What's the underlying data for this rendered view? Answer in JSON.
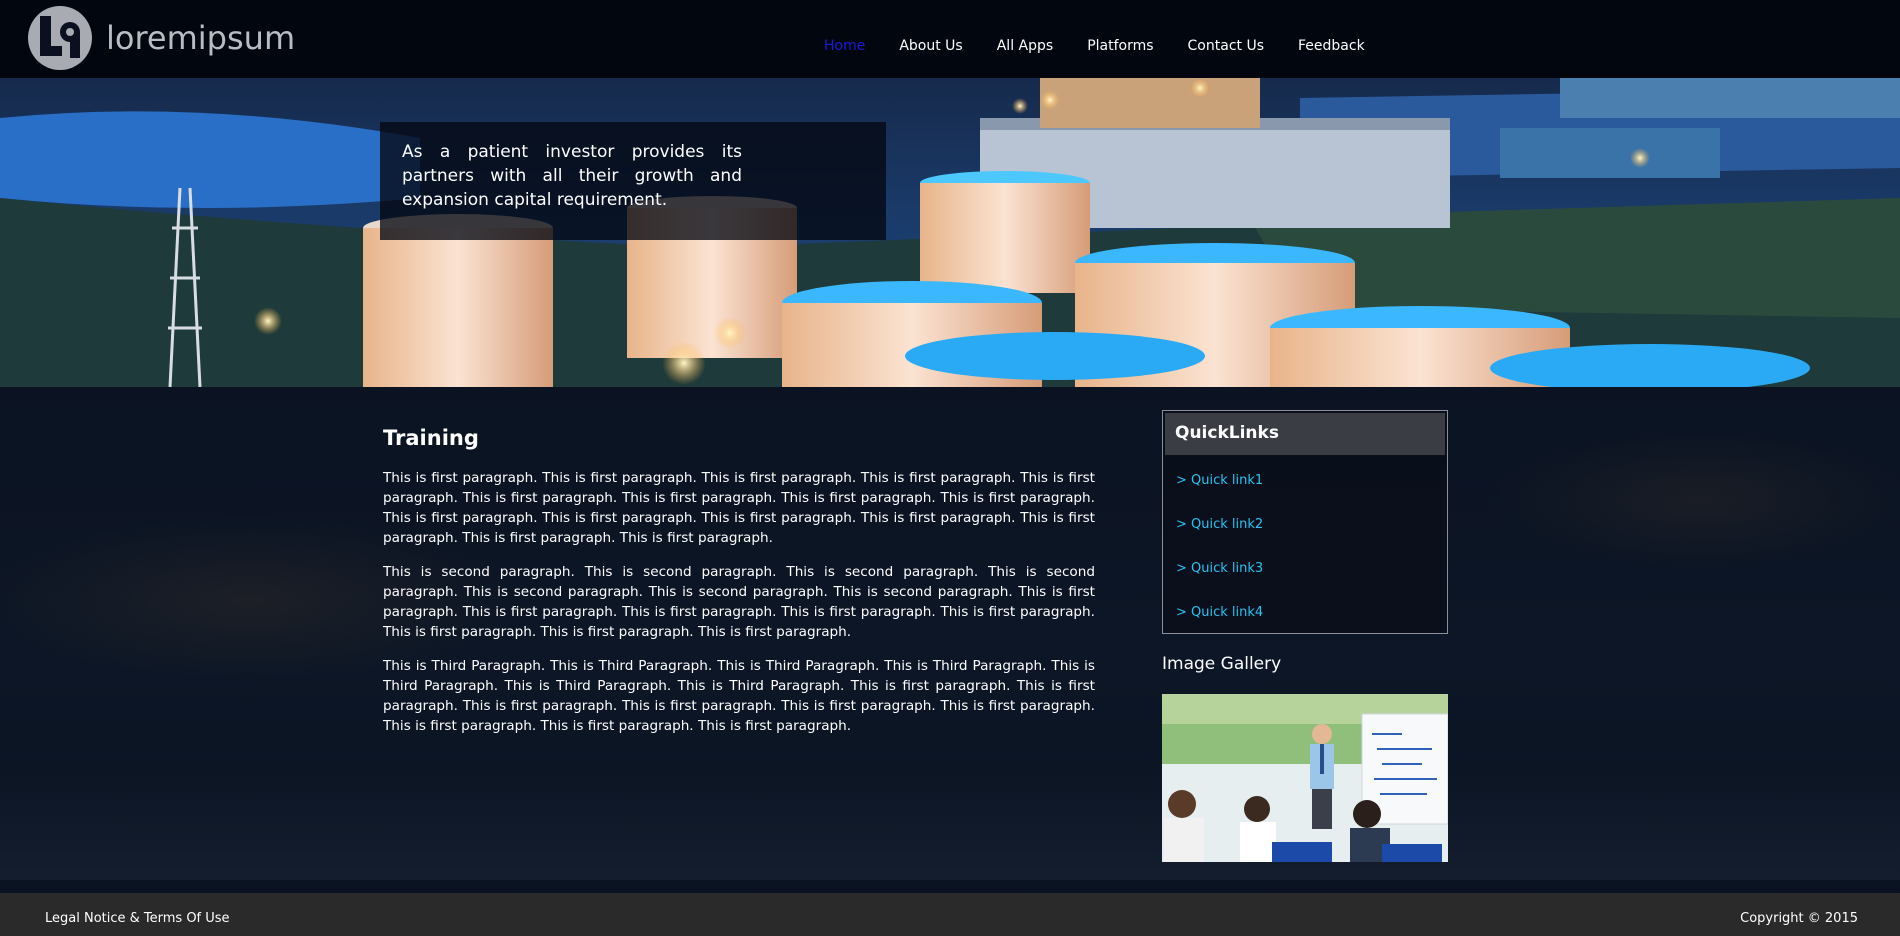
{
  "brand": {
    "name": "loremipsum"
  },
  "nav": {
    "items": [
      {
        "label": "Home",
        "active": true
      },
      {
        "label": "About Us"
      },
      {
        "label": "All Apps"
      },
      {
        "label": "Platforms"
      },
      {
        "label": "Contact Us"
      },
      {
        "label": "Feedback"
      }
    ]
  },
  "hero": {
    "caption": "As a patient investor provides its partners with all their growth and expansion capital requirement."
  },
  "main": {
    "title": "Training",
    "paragraphs": [
      "This is first paragraph. This is first paragraph. This is first paragraph. This is first paragraph. This is first paragraph. This is first paragraph. This is first paragraph. This is first paragraph. This is first paragraph. This is first paragraph. This is first paragraph. This is first paragraph. This is first paragraph. This is first paragraph. This is first paragraph. This is first paragraph.",
      "This is second paragraph. This is second paragraph. This is second paragraph. This is second paragraph. This is second paragraph. This is second paragraph. This is second paragraph. This is first paragraph. This is first paragraph. This is first paragraph. This is first paragraph. This is first paragraph. This is first paragraph. This is first paragraph. This is first paragraph.",
      "This is Third Paragraph. This is Third Paragraph. This is Third Paragraph. This is Third Paragraph. This is Third Paragraph. This is Third Paragraph. This is Third Paragraph. This is first paragraph. This is first paragraph. This is first paragraph. This is first paragraph. This is first paragraph. This is first paragraph. This is first paragraph. This is first paragraph. This is first paragraph."
    ]
  },
  "sidebar": {
    "quicklinks_title": "QuickLinks",
    "links": [
      "> Quick link1",
      "> Quick link2",
      "> Quick link3",
      "> Quick link4"
    ],
    "gallery_title": "Image Gallery"
  },
  "footer": {
    "legal": "Legal Notice & Terms Of Use",
    "copyright": "Copyright © 2015"
  },
  "colors": {
    "nav_active": "#1a1ad8",
    "link": "#27c3f2",
    "footer_bg": "#2a2a2a"
  }
}
